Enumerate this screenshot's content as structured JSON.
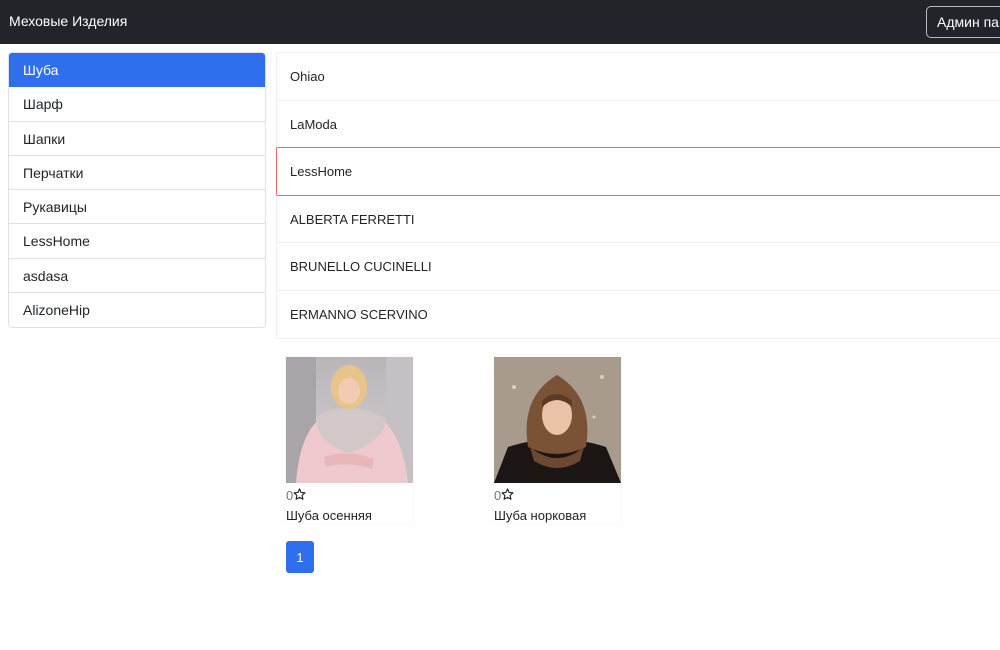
{
  "navbar": {
    "brand": "Меховые Изделия",
    "admin_label": "Админ панель"
  },
  "sidebar": {
    "items": [
      {
        "label": "Шуба",
        "active": true
      },
      {
        "label": "Шарф"
      },
      {
        "label": "Шапки"
      },
      {
        "label": "Перчатки"
      },
      {
        "label": "Рукавицы"
      },
      {
        "label": "LessHome"
      },
      {
        "label": "asdasa"
      },
      {
        "label": "AlizoneHip"
      }
    ]
  },
  "brands": {
    "items": [
      {
        "label": "Ohiao"
      },
      {
        "label": "LaModa"
      },
      {
        "label": "LessHome",
        "selected": true
      },
      {
        "label": "ALBERTA FERRETTI"
      },
      {
        "label": "BRUNELLO CUCINELLI"
      },
      {
        "label": "ERMANNO SCERVINO"
      }
    ]
  },
  "products": [
    {
      "rating": "0",
      "title": "Шуба осенняя",
      "icon": "star-outline-icon"
    },
    {
      "rating": "0",
      "title": "Шуба норковая",
      "icon": "star-outline-icon"
    }
  ],
  "pagination": {
    "current": "1"
  },
  "colors": {
    "navbar_bg": "#212529",
    "accent": "#2f6fee",
    "selected_border": "#e86a6a"
  }
}
